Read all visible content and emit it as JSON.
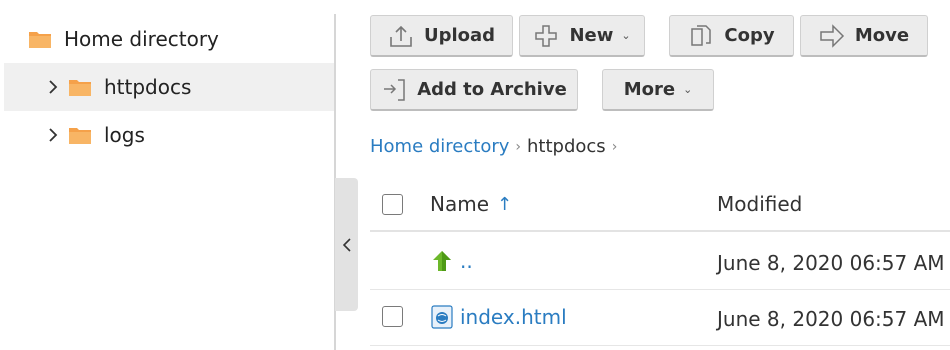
{
  "sidebar": {
    "root": {
      "label": "Home directory",
      "icon": "folder-icon"
    },
    "items": [
      {
        "label": "httpdocs",
        "icon": "folder-icon",
        "selected": true
      },
      {
        "label": "logs",
        "icon": "folder-icon",
        "selected": false
      }
    ]
  },
  "toolbar": {
    "upload_label": "Upload",
    "new_label": "New",
    "copy_label": "Copy",
    "move_label": "Move",
    "archive_label": "Add to Archive",
    "more_label": "More",
    "caret": "⌄"
  },
  "breadcrumb": {
    "home": "Home directory",
    "current": "httpdocs",
    "separator": "›"
  },
  "table": {
    "columns": {
      "name": "Name",
      "modified": "Modified",
      "sort_indicator": "↑"
    },
    "rows": [
      {
        "name": "..",
        "modified": "June 8, 2020 06:57 AM",
        "icon": "up-arrow-icon",
        "has_checkbox": false
      },
      {
        "name": "index.html",
        "modified": "June 8, 2020 06:57 AM",
        "icon": "html-file-icon",
        "has_checkbox": true
      }
    ]
  },
  "colors": {
    "link": "#2a7cc1",
    "folder": "#f5a14a",
    "button_bg": "#ececec",
    "selected_row": "#f0f0f0"
  }
}
